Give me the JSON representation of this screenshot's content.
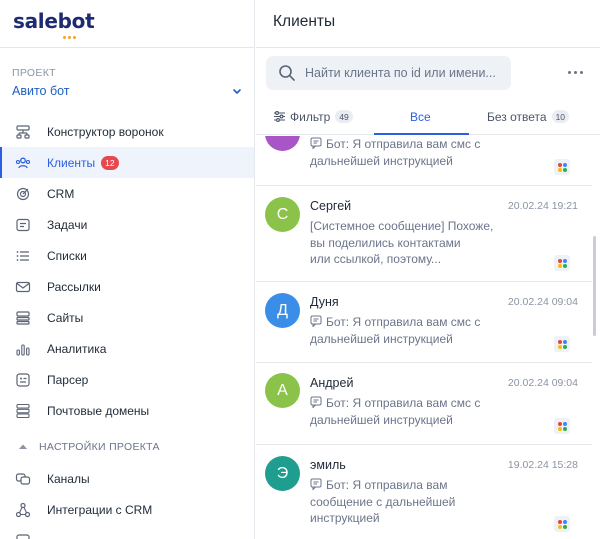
{
  "sidebar": {
    "logo": "salebot",
    "project_label": "ПРОЕКТ",
    "project_name": "Авито бот",
    "items": [
      {
        "label": "Конструктор воронок",
        "icon": "funnel-builder-icon"
      },
      {
        "label": "Клиенты",
        "icon": "clients-icon",
        "badge": "12",
        "active": true
      },
      {
        "label": "CRM",
        "icon": "crm-icon"
      },
      {
        "label": "Задачи",
        "icon": "tasks-icon"
      },
      {
        "label": "Списки",
        "icon": "lists-icon"
      },
      {
        "label": "Рассылки",
        "icon": "mail-icon"
      },
      {
        "label": "Сайты",
        "icon": "sites-icon"
      },
      {
        "label": "Аналитика",
        "icon": "analytics-icon"
      },
      {
        "label": "Парсер",
        "icon": "parser-icon"
      },
      {
        "label": "Почтовые домены",
        "icon": "mail-domains-icon"
      }
    ],
    "settings_section": "НАСТРОЙКИ ПРОЕКТА",
    "settings_items": [
      {
        "label": "Каналы",
        "icon": "channels-icon"
      },
      {
        "label": "Интеграции с CRM",
        "icon": "integrations-icon"
      }
    ]
  },
  "main": {
    "title": "Клиенты",
    "search_placeholder": "Найти клиента по id или имени...",
    "tabs": [
      {
        "label": "Фильтр",
        "badge": "49"
      },
      {
        "label": "Все"
      },
      {
        "label": "Без ответа",
        "badge": "10"
      }
    ],
    "chats": [
      {
        "name": "",
        "initial": "",
        "time": "",
        "color": "#a855c7",
        "lines": [
          "Бот: Я отправила вам смс с",
          "дальнейшей инструкцией"
        ],
        "bot": true
      },
      {
        "name": "Сергей",
        "initial": "С",
        "time": "20.02.24 19:21",
        "color": "#8bc34a",
        "lines": [
          "[Системное сообщение] Похоже,",
          "вы поделились контактами",
          "или ссылкой, поэтому..."
        ],
        "bot": false
      },
      {
        "name": "Дуня",
        "initial": "Д",
        "time": "20.02.24 09:04",
        "color": "#3b8ee8",
        "lines": [
          "Бот: Я отправила вам смс с",
          "дальнейшей инструкцией"
        ],
        "bot": true
      },
      {
        "name": "Андрей",
        "initial": "А",
        "time": "20.02.24 09:04",
        "color": "#8bc34a",
        "lines": [
          "Бот: Я отправила вам смс с",
          "дальнейшей инструкцией"
        ],
        "bot": true
      },
      {
        "name": "эмиль",
        "initial": "Э",
        "time": "19.02.24 15:28",
        "color": "#1f9e8f",
        "lines": [
          "Бот: Я отправила вам",
          "сообщение с дальнейшей",
          "инструкцией"
        ],
        "bot": true
      }
    ]
  },
  "colors": {
    "accent": "#2b5ee3",
    "badge": "#e5484d"
  }
}
